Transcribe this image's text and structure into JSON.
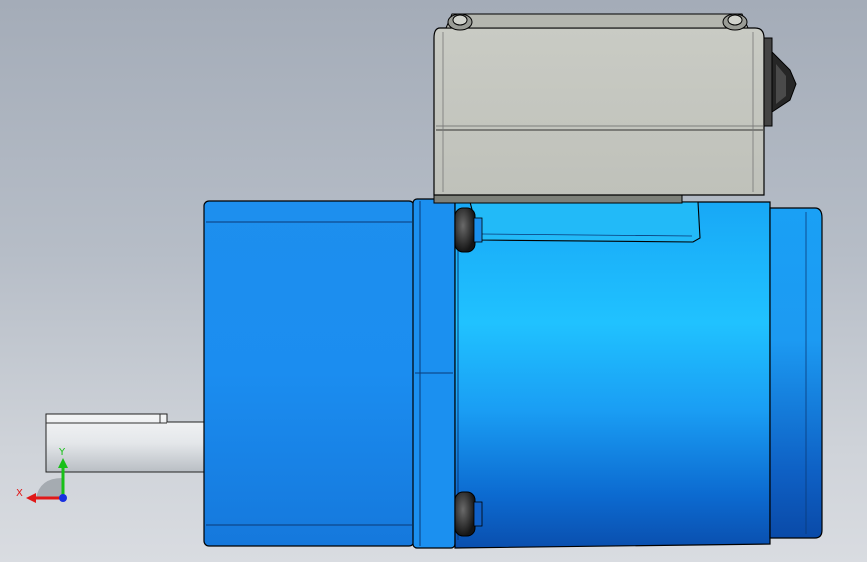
{
  "viewport": {
    "background_top": "#a4acb8",
    "background_bottom": "#d9dce1"
  },
  "model": {
    "body_color": "#1a8ef0",
    "body_highlight": "#20c4ff",
    "terminal_box_color": "#c8cac4",
    "shaft_color": "#e8ebee",
    "screw_color": "#2a2a2a"
  },
  "triad": {
    "x_label": "X",
    "y_label": "Y",
    "x_color": "#e01818",
    "y_color": "#18c018",
    "z_color": "#1830e0"
  }
}
